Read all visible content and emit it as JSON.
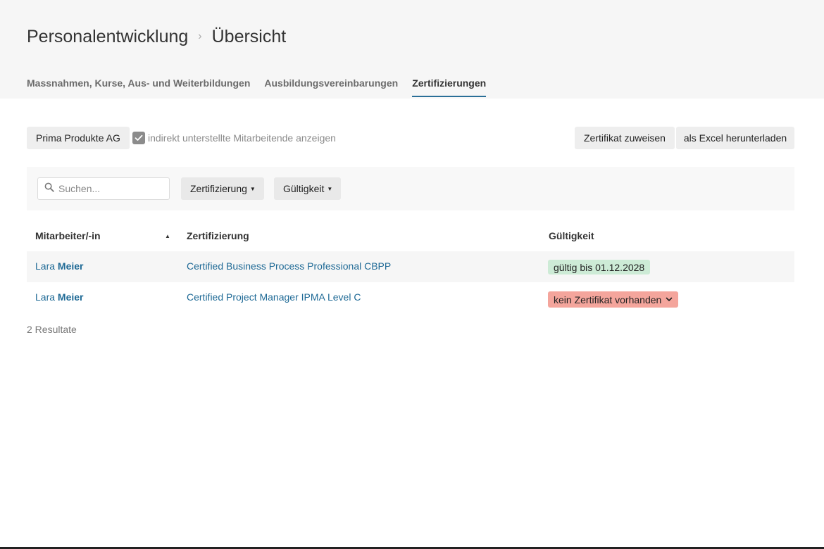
{
  "breadcrumb": {
    "section": "Personalentwicklung",
    "page": "Übersicht"
  },
  "tabs": [
    {
      "label": "Massnahmen, Kurse, Aus- und Weiterbildungen",
      "active": false
    },
    {
      "label": "Ausbildungsvereinbarungen",
      "active": false
    },
    {
      "label": "Zertifizierungen",
      "active": true
    }
  ],
  "toolbar": {
    "company": "Prima Produkte AG",
    "indirect_label": "indirekt unterstellte Mitarbeitende anzeigen",
    "indirect_checked": true,
    "assign_label": "Zertifikat zuweisen",
    "excel_label": "als Excel herunterladen"
  },
  "filters": {
    "search_placeholder": "Suchen...",
    "certification_label": "Zertifizierung",
    "validity_label": "Gültigkeit"
  },
  "table": {
    "columns": [
      "Mitarbeiter/-in",
      "Zertifizierung",
      "Gültigkeit"
    ],
    "rows": [
      {
        "first_name": "Lara",
        "last_name": "Meier",
        "certification": "Certified Business Process Professional CBPP",
        "validity": "gültig bis 01.12.2028",
        "status": "valid"
      },
      {
        "first_name": "Lara",
        "last_name": "Meier",
        "certification": "Certified Project Manager IPMA Level C",
        "validity": "kein Zertifikat vorhanden",
        "status": "missing"
      }
    ]
  },
  "results_label": "2 Resultate",
  "colors": {
    "link": "#1f6a96",
    "tab_underline": "#2a6f97",
    "valid_badge": "#cdebd6",
    "missing_badge": "#f4a59c"
  }
}
